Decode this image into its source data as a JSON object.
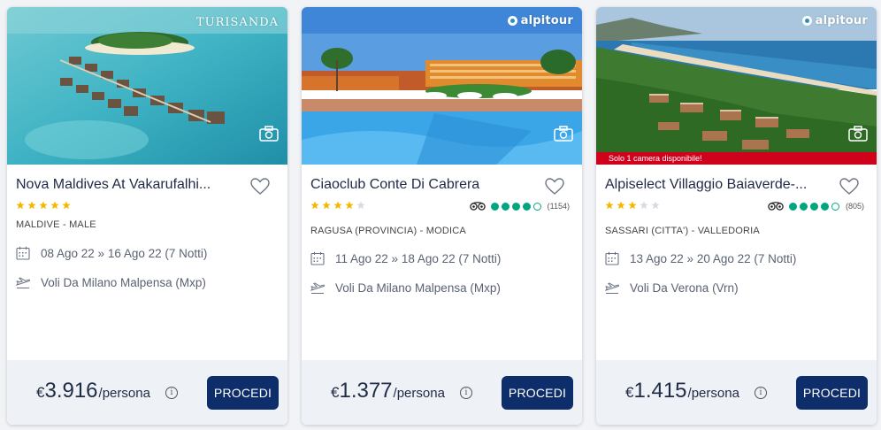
{
  "cards": [
    {
      "brand": "TURISANDA",
      "banner": "",
      "title": "Nova Maldives At Vakarufalhi...",
      "stars": 5,
      "rating_bubbles": null,
      "reviews": "",
      "location": "MALDIVE - MALE",
      "dates": "08 Ago 22 » 16 Ago 22 (7 Notti)",
      "flights": "Voli Da Milano Malpensa (Mxp)",
      "currency": "€",
      "price": "3.916",
      "per": "/persona",
      "button": "PROCEDI"
    },
    {
      "brand": "alpitour",
      "banner": "",
      "title": "Ciaoclub Conte Di Cabrera",
      "stars": 4,
      "rating_bubbles": 4,
      "reviews": "(1154)",
      "location": "RAGUSA (PROVINCIA) - MODICA",
      "dates": "11 Ago 22 » 18 Ago 22 (7 Notti)",
      "flights": "Voli Da Milano Malpensa (Mxp)",
      "currency": "€",
      "price": "1.377",
      "per": "/persona",
      "button": "PROCEDI"
    },
    {
      "brand": "alpitour",
      "banner": "Solo 1 camera disponibile!",
      "title": "Alpiselect Villaggio Baiaverde-...",
      "stars": 3,
      "rating_bubbles": 4,
      "reviews": "(805)",
      "location": "SASSARI (CITTA') - VALLEDORIA",
      "dates": "13 Ago 22 » 20 Ago 22 (7 Notti)",
      "flights": "Voli Da Verona (Vrn)",
      "currency": "€",
      "price": "1.415",
      "per": "/persona",
      "button": "PROCEDI"
    }
  ],
  "colors": {
    "star": "#f5b700",
    "star_empty": "#d6dae2",
    "tripadvisor": "#00a680",
    "button": "#0e2d6b",
    "footer": "#eef1f6",
    "banner": "#d0021b"
  },
  "icons": [
    "camera-icon",
    "heart-icon",
    "star-icon",
    "tripadvisor-icon",
    "calendar-icon",
    "plane-icon",
    "info-icon"
  ]
}
